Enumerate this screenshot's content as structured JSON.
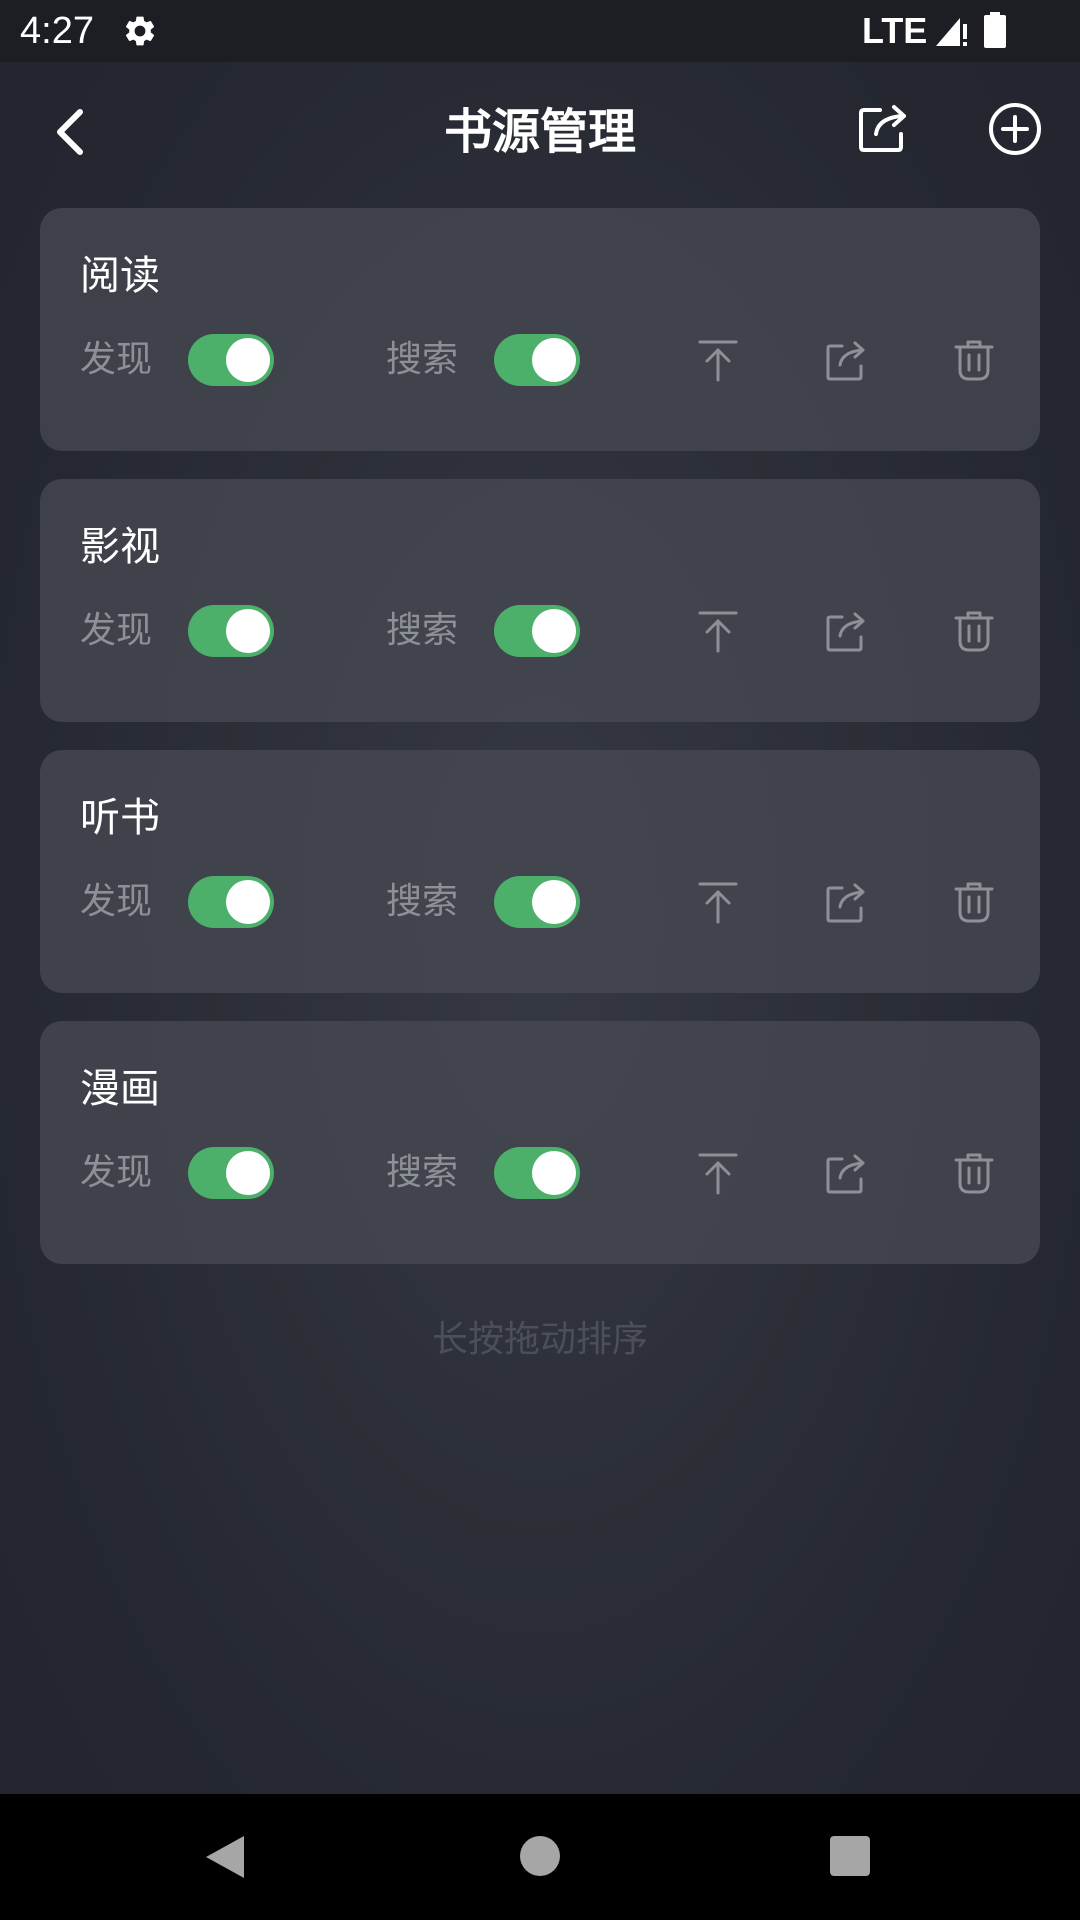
{
  "status_bar": {
    "time": "4:27",
    "network": "LTE",
    "icons": [
      "gear-icon",
      "signal-icon",
      "battery-icon"
    ]
  },
  "app_bar": {
    "title": "书源管理",
    "icons": [
      "back-arrow-icon",
      "share-export-icon",
      "add-circle-icon"
    ]
  },
  "cards": [
    {
      "title": "阅读",
      "discover_label": "发现",
      "search_label": "搜索",
      "discover_on": true,
      "search_on": true
    },
    {
      "title": "影视",
      "discover_label": "发现",
      "search_label": "搜索",
      "discover_on": true,
      "search_on": true
    },
    {
      "title": "听书",
      "discover_label": "发现",
      "search_label": "搜索",
      "discover_on": true,
      "search_on": true
    },
    {
      "title": "漫画",
      "discover_label": "发现",
      "search_label": "搜索",
      "discover_on": true,
      "search_on": true
    }
  ],
  "card_action_icons": [
    "move-to-top-icon",
    "export-icon",
    "trash-icon"
  ],
  "hint": "长按拖动排序",
  "nav_bar": {
    "icons": [
      "nav-back-icon",
      "nav-home-icon",
      "nav-recents-icon"
    ]
  },
  "colors": {
    "toggle_on": "#4caf6a",
    "card_bg": "#464952",
    "label": "#8e9098"
  }
}
